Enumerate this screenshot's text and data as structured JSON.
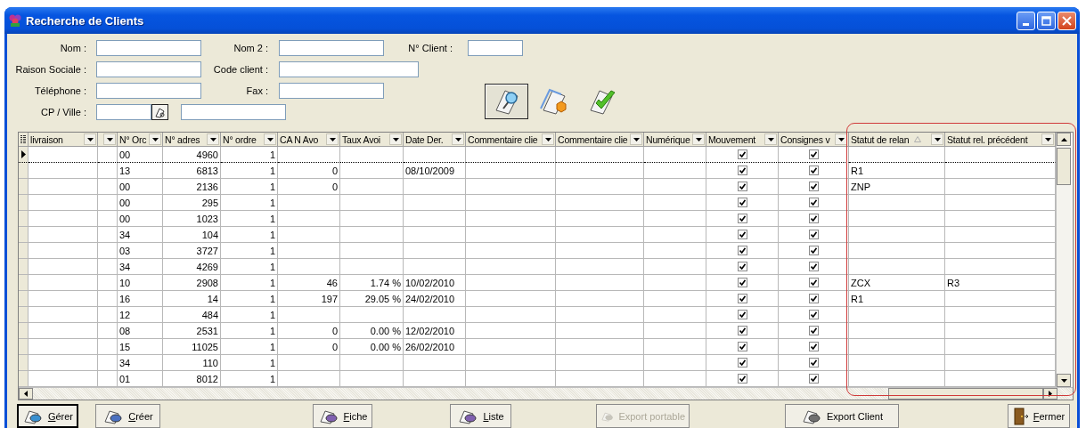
{
  "window": {
    "title": "Recherche de Clients"
  },
  "form": {
    "rows": [
      [
        {
          "label": "Nom :",
          "kind": "text"
        },
        {
          "label": "Nom 2 :",
          "kind": "text"
        },
        {
          "label": "N° Client :",
          "kind": "text"
        }
      ],
      [
        {
          "label": "Raison Sociale :",
          "kind": "text"
        },
        {
          "label": "Code client :",
          "kind": "text"
        }
      ],
      [
        {
          "label": "Téléphone :",
          "kind": "text"
        },
        {
          "label": "Fax :",
          "kind": "text"
        }
      ],
      [
        {
          "label": "CP / Ville :",
          "kind": "postal"
        }
      ]
    ]
  },
  "toolbar": [
    {
      "selected": true
    },
    {
      "selected": false
    },
    {
      "selected": false
    }
  ],
  "table": {
    "columns": [
      {
        "label": "livraison",
        "kind": "text",
        "sorted": false
      },
      {
        "kind": "text",
        "sorted": false
      },
      {
        "label": "N° Orc",
        "kind": "text",
        "sorted": false
      },
      {
        "label": "N° adres",
        "kind": "number",
        "sorted": false
      },
      {
        "label": "N° ordre",
        "kind": "number",
        "sorted": false
      },
      {
        "label": "CA N Avo",
        "kind": "number",
        "sorted": false
      },
      {
        "label": "Taux Avoi",
        "kind": "number",
        "sorted": false
      },
      {
        "label": "Date Der.",
        "kind": "text",
        "sorted": false
      },
      {
        "label": "Commentaire clie",
        "kind": "text",
        "sorted": false
      },
      {
        "label": "Commentaire clie",
        "kind": "text",
        "sorted": false
      },
      {
        "label": "Numérique",
        "kind": "text",
        "sorted": false
      },
      {
        "label": "Mouvement",
        "kind": "check",
        "sorted": false
      },
      {
        "label": "Consignes v",
        "kind": "check",
        "sorted": false
      },
      {
        "label": "Statut de relan",
        "kind": "text",
        "sorted": true
      },
      {
        "label": "Statut rel. précédent",
        "kind": "text",
        "sorted": false
      }
    ],
    "rows": [
      {
        "selected": true,
        "cells": [
          null,
          null,
          "00",
          "4960",
          "1",
          null,
          null,
          null,
          null,
          null,
          null,
          true,
          true,
          null,
          null
        ]
      },
      {
        "selected": false,
        "cells": [
          null,
          null,
          "13",
          "6813",
          "1",
          "0",
          null,
          "08/10/2009",
          null,
          null,
          null,
          true,
          true,
          "R1",
          null
        ]
      },
      {
        "selected": false,
        "cells": [
          null,
          null,
          "00",
          "2136",
          "1",
          "0",
          null,
          null,
          null,
          null,
          null,
          true,
          true,
          "ZNP",
          null
        ]
      },
      {
        "selected": false,
        "cells": [
          null,
          null,
          "00",
          "295",
          "1",
          null,
          null,
          null,
          null,
          null,
          null,
          true,
          true,
          null,
          null
        ]
      },
      {
        "selected": false,
        "cells": [
          null,
          null,
          "00",
          "1023",
          "1",
          null,
          null,
          null,
          null,
          null,
          null,
          true,
          true,
          null,
          null
        ]
      },
      {
        "selected": false,
        "cells": [
          null,
          null,
          "34",
          "104",
          "1",
          null,
          null,
          null,
          null,
          null,
          null,
          true,
          true,
          null,
          null
        ]
      },
      {
        "selected": false,
        "cells": [
          null,
          null,
          "03",
          "3727",
          "1",
          null,
          null,
          null,
          null,
          null,
          null,
          true,
          true,
          null,
          null
        ]
      },
      {
        "selected": false,
        "cells": [
          null,
          null,
          "34",
          "4269",
          "1",
          null,
          null,
          null,
          null,
          null,
          null,
          true,
          true,
          null,
          null
        ]
      },
      {
        "selected": false,
        "cells": [
          null,
          null,
          "10",
          "2908",
          "1",
          "46",
          "1.74 %",
          "10/02/2010",
          null,
          null,
          null,
          true,
          true,
          "ZCX",
          "R3"
        ]
      },
      {
        "selected": false,
        "cells": [
          null,
          null,
          "16",
          "14",
          "1",
          "197",
          "29.05 %",
          "24/02/2010",
          null,
          null,
          null,
          true,
          true,
          "R1",
          null
        ]
      },
      {
        "selected": false,
        "cells": [
          null,
          null,
          "12",
          "484",
          "1",
          null,
          null,
          null,
          null,
          null,
          null,
          true,
          true,
          null,
          null
        ]
      },
      {
        "selected": false,
        "cells": [
          null,
          null,
          "08",
          "2531",
          "1",
          "0",
          "0.00 %",
          "12/02/2010",
          null,
          null,
          null,
          true,
          true,
          null,
          null
        ]
      },
      {
        "selected": false,
        "cells": [
          null,
          null,
          "15",
          "11025",
          "1",
          "0",
          "0.00 %",
          "26/02/2010",
          null,
          null,
          null,
          true,
          true,
          null,
          null
        ]
      },
      {
        "selected": false,
        "cells": [
          null,
          null,
          "34",
          "110",
          "1",
          null,
          null,
          null,
          null,
          null,
          null,
          true,
          true,
          null,
          null
        ]
      },
      {
        "selected": false,
        "cells": [
          null,
          null,
          "01",
          "8012",
          "1",
          null,
          null,
          null,
          null,
          null,
          null,
          true,
          true,
          null,
          null
        ]
      }
    ]
  },
  "buttons": [
    {
      "label": "Gérer",
      "mnemonic": true,
      "disabled": false,
      "default": true
    },
    {
      "label": "Créer",
      "mnemonic": true,
      "disabled": false,
      "default": false
    },
    {
      "label": "Fiche",
      "mnemonic": true,
      "disabled": false,
      "default": false
    },
    {
      "label": "Liste",
      "mnemonic": true,
      "disabled": false,
      "default": false
    },
    {
      "label": "Export portable",
      "mnemonic": false,
      "disabled": true,
      "default": false
    },
    {
      "label": "Export Client",
      "mnemonic": false,
      "disabled": false,
      "default": false
    },
    {
      "label": "Fermer",
      "mnemonic": true,
      "disabled": false,
      "default": false
    }
  ]
}
